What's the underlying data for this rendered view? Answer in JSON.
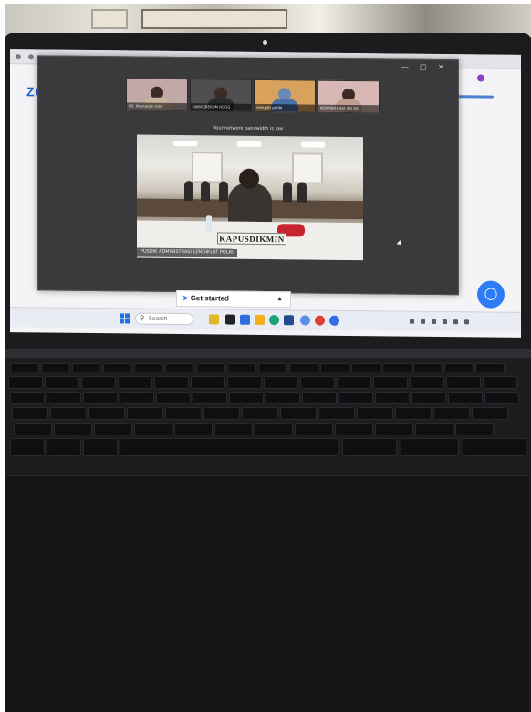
{
  "browser": {
    "app_logo": "ZOO"
  },
  "meeting": {
    "participants": [
      {
        "name": "PD. Mainarjah ildin"
      },
      {
        "name": "KABAGBEKUM ROGG"
      },
      {
        "name": "sempah polda"
      },
      {
        "name": "KORPSKHUDA STI AS"
      }
    ],
    "bandwidth_notice": "Your network bandwidth is low",
    "nameplate": "KAPUSDIKMIN",
    "active_speaker_caption": "PUSDIK ADMINISTRASI LEMDIKLAT POLRI"
  },
  "get_started": {
    "label": "Get started"
  },
  "taskbar": {
    "search_placeholder": "Search"
  },
  "icons": {
    "rocket": "rocket-icon",
    "start": "windows-start-icon",
    "chat": "chat-bubble-icon"
  },
  "colors": {
    "zoom_blue": "#1b65d4",
    "chat_fab": "#2d7cf6",
    "flowers": "#c72430"
  }
}
